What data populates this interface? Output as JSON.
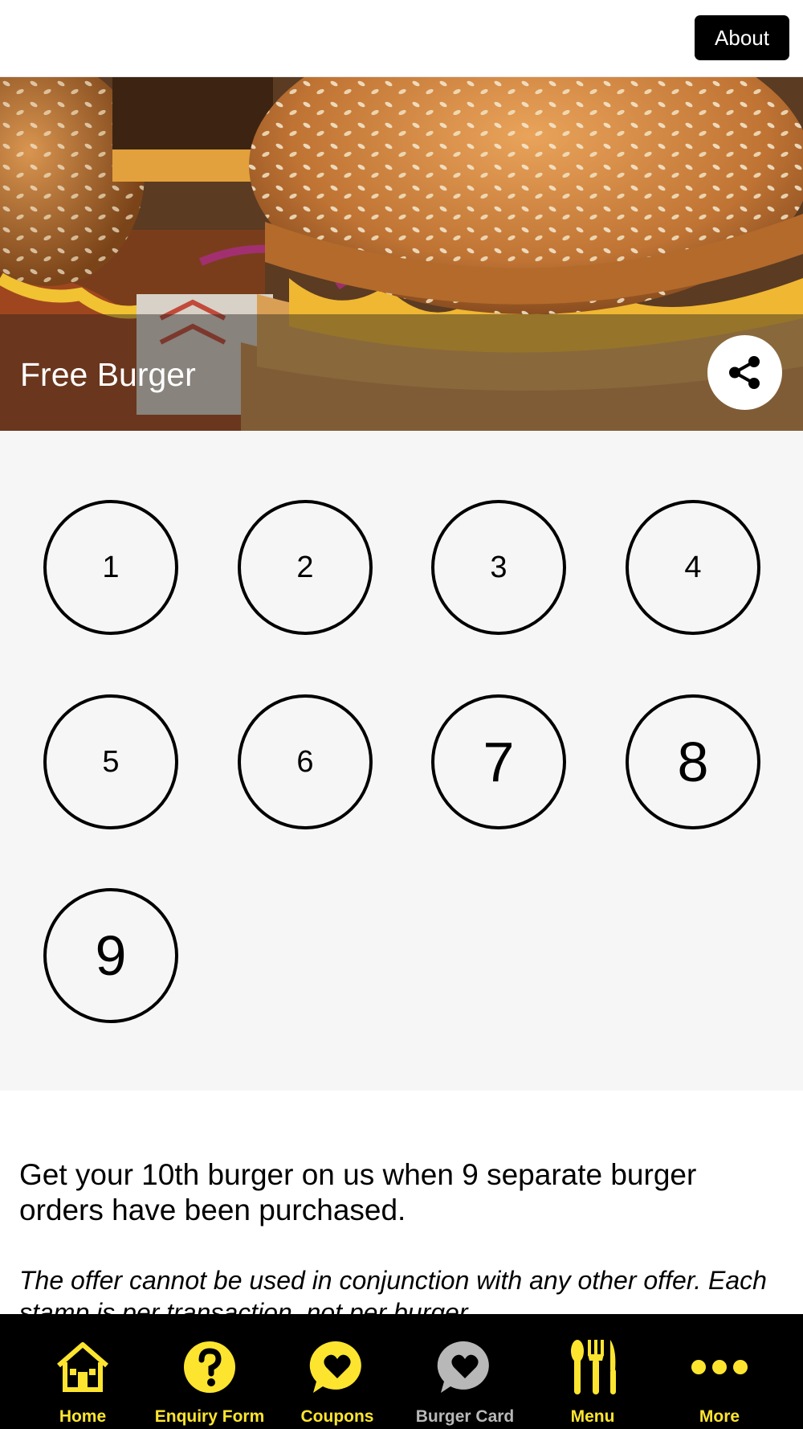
{
  "header": {
    "about_label": "About"
  },
  "hero": {
    "title": "Free Burger",
    "share_icon": "share-icon"
  },
  "stamps": [
    "1",
    "2",
    "3",
    "4",
    "5",
    "6",
    "7",
    "8",
    "9"
  ],
  "description": {
    "main": "Get your 10th burger on us when 9 separate burger orders have been purchased.",
    "terms": "The offer cannot be used in conjunction with any other offer. Each stamp is per transaction, not per burger."
  },
  "nav": {
    "items": [
      {
        "label": "Home",
        "icon": "home-icon"
      },
      {
        "label": "Enquiry Form",
        "icon": "question-icon"
      },
      {
        "label": "Coupons",
        "icon": "heart-bubble-icon"
      },
      {
        "label": "Burger Card",
        "icon": "heart-bubble-icon"
      },
      {
        "label": "Menu",
        "icon": "cutlery-icon"
      },
      {
        "label": "More",
        "icon": "more-dots-icon"
      }
    ]
  },
  "colors": {
    "accent": "#fde52f",
    "nav_bg": "#000000",
    "inactive": "#b8b8b8",
    "stamp_bg": "#f6f6f6"
  }
}
